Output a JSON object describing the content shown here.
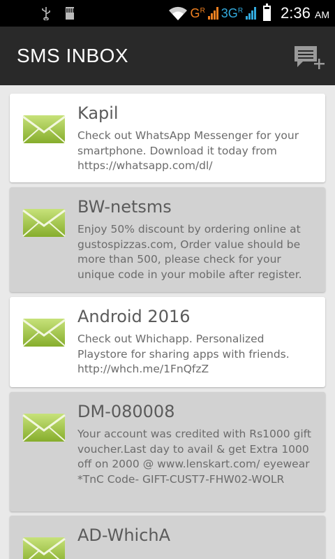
{
  "status_bar": {
    "net1_label": "G",
    "net1_sup": "R",
    "net2_label": "3G",
    "net2_sup": "R",
    "time": "2:36",
    "ampm": "AM"
  },
  "app_bar": {
    "title": "SMS INBOX",
    "compose_icon": "compose-message-icon"
  },
  "messages": [
    {
      "sender": "Kapil",
      "body": "Check out WhatsApp Messenger for your smartphone. Download it today from https://whatsapp.com/dl/"
    },
    {
      "sender": "BW-netsms",
      "body": "Enjoy 50% discount by ordering online at gustospizzas.com, Order value should be more than 500, please check for your unique code in your mobile after register."
    },
    {
      "sender": "Android 2016",
      "body": "Check out Whichapp. Personalized Playstore for sharing apps with friends. http://whch.me/1FnQfzZ"
    },
    {
      "sender": "DM-080008",
      "body": "Your account was credited with Rs1000 gift voucher.Last day to avail & get Extra 1000 off on 2000 @ www.lenskart.com/ eyewear *TnC Code- GIFT-CUST7-FHW02-WOLR"
    },
    {
      "sender": "AD-WhichA",
      "body": ""
    }
  ],
  "colors": {
    "app_bar": "#292929",
    "card_even": "#ffffff",
    "card_odd": "#d2d2d2",
    "envelope": "#9bc23e"
  }
}
